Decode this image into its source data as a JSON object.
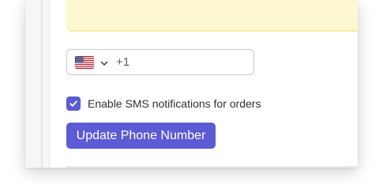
{
  "phone": {
    "country_code": "+1",
    "country_flag_icon": "us-flag-icon",
    "dropdown_icon": "chevron-down-icon",
    "value": "",
    "placeholder": ""
  },
  "sms": {
    "checked": true,
    "label": "Enable SMS notifications for orders"
  },
  "actions": {
    "update_label": "Update Phone Number"
  },
  "colors": {
    "accent": "#5b5bd6",
    "banner": "#fdf8d0",
    "border": "#c9c9cf"
  }
}
